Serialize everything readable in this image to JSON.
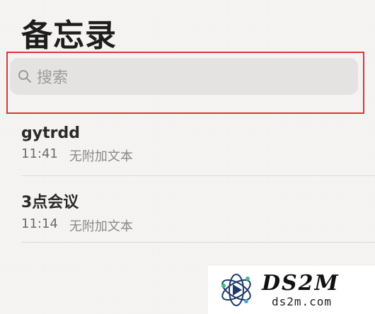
{
  "app": {
    "title": "备忘录"
  },
  "search": {
    "placeholder": "搜索",
    "icon": "search-icon"
  },
  "notes": [
    {
      "title": "gytrdd",
      "time": "11:41",
      "preview": "无附加文本"
    },
    {
      "title": "3点会议",
      "time": "11:14",
      "preview": "无附加文本"
    }
  ],
  "watermark": {
    "brand": "DS2M",
    "site": "ds2m.com"
  },
  "colors": {
    "background": "#f6f5f3",
    "highlight": "#d9383a",
    "search_bg": "#e4e3e1"
  }
}
